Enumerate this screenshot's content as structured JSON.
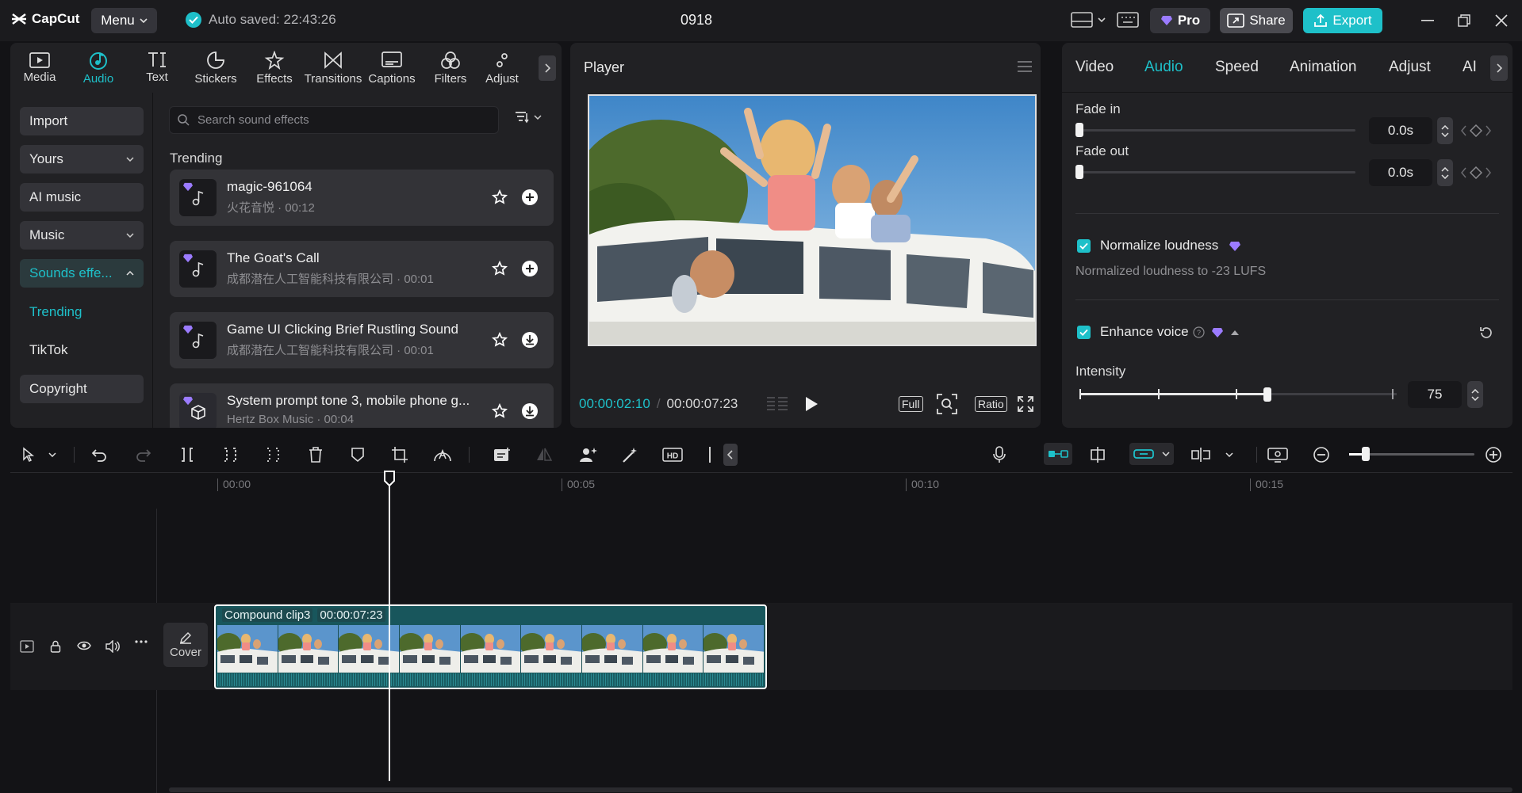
{
  "titlebar": {
    "app_name": "CapCut",
    "menu_label": "Menu",
    "autosave_text": "Auto saved: 22:43:26",
    "project_title": "0918",
    "pro_label": "Pro",
    "share_label": "Share",
    "export_label": "Export"
  },
  "tool_tabs": [
    {
      "label": "Media",
      "icon": "media-icon"
    },
    {
      "label": "Audio",
      "icon": "audio-icon",
      "active": true
    },
    {
      "label": "Text",
      "icon": "text-icon"
    },
    {
      "label": "Stickers",
      "icon": "stickers-icon"
    },
    {
      "label": "Effects",
      "icon": "effects-icon"
    },
    {
      "label": "Transitions",
      "icon": "transitions-icon"
    },
    {
      "label": "Captions",
      "icon": "captions-icon"
    },
    {
      "label": "Filters",
      "icon": "filters-icon"
    },
    {
      "label": "Adjust",
      "icon": "adjust-icon"
    }
  ],
  "left_nav": {
    "import": "Import",
    "yours": "Yours",
    "ai_music": "AI music",
    "music": "Music",
    "sound_effects": "Sounds effe...",
    "trending": "Trending",
    "tiktok": "TikTok",
    "copyright": "Copyright"
  },
  "sound_panel": {
    "search_placeholder": "Search sound effects",
    "section_title": "Trending",
    "items": [
      {
        "name": "magic-961064",
        "meta": "火花音悦 · 00:12",
        "action": "add"
      },
      {
        "name": "The Goat's Call",
        "meta": "成都潜在人工智能科技有限公司 · 00:01",
        "action": "add"
      },
      {
        "name": "Game UI Clicking Brief Rustling Sound",
        "meta": "成都潜在人工智能科技有限公司 · 00:01",
        "action": "download"
      },
      {
        "name": "System prompt tone 3, mobile phone g...",
        "meta": "Hertz Box Music · 00:04",
        "action": "download"
      }
    ]
  },
  "player": {
    "title": "Player",
    "current_time": "00:00:02:10",
    "total_time": "00:00:07:23",
    "full_label": "Full",
    "ratio_label": "Ratio"
  },
  "inspector": {
    "tabs": [
      "Video",
      "Audio",
      "Speed",
      "Animation",
      "Adjust",
      "AI"
    ],
    "active_tab": "Audio",
    "fade_in_label": "Fade in",
    "fade_in_value": "0.0s",
    "fade_out_label": "Fade out",
    "fade_out_value": "0.0s",
    "normalize_label": "Normalize loudness",
    "normalize_checked": true,
    "normalize_desc": "Normalized loudness to -23 LUFS",
    "enhance_label": "Enhance voice",
    "enhance_checked": true,
    "intensity_label": "Intensity",
    "intensity_value": "75",
    "intensity_fraction": 0.75
  },
  "timeline": {
    "ruler": [
      "00:00",
      "00:05",
      "00:10",
      "00:15"
    ],
    "cover_label": "Cover",
    "clip_name": "Compound clip3",
    "clip_duration": "00:00:07:23"
  },
  "colors": {
    "accent": "#1ec0c9",
    "pro_gem": "#9b7bff"
  }
}
